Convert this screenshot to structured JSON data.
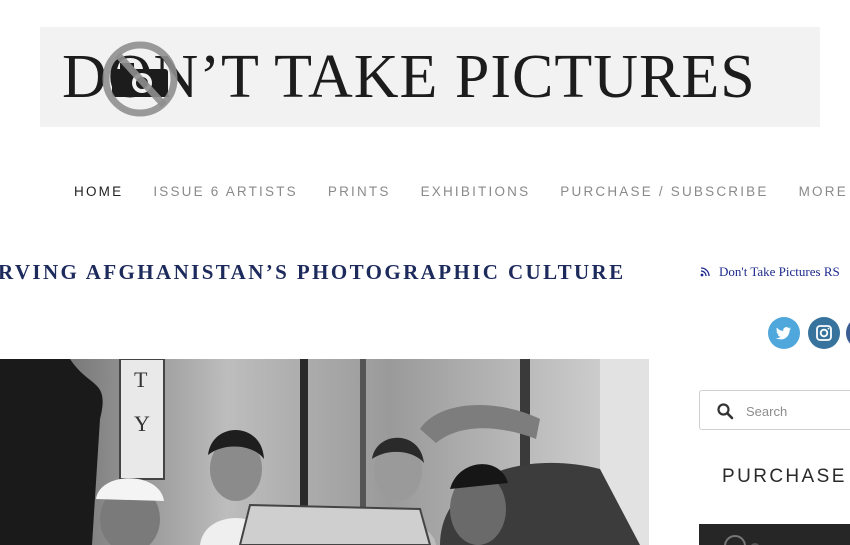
{
  "header": {
    "logo_text": "DON’T TAKE PICTURES"
  },
  "nav": {
    "items": [
      {
        "label": "HOME",
        "active": true
      },
      {
        "label": "ISSUE 6 ARTISTS",
        "active": false
      },
      {
        "label": "PRINTS",
        "active": false
      },
      {
        "label": "EXHIBITIONS",
        "active": false
      },
      {
        "label": "PURCHASE / SUBSCRIBE",
        "active": false
      },
      {
        "label": "MORE",
        "active": false
      }
    ]
  },
  "post": {
    "title": "RVING AFGHANISTAN’S PHOTOGRAPHIC CULTURE"
  },
  "sidebar": {
    "rss_label": "Don't Take Pictures RS",
    "social": [
      "twitter-icon",
      "instagram-icon",
      "facebook-icon"
    ],
    "search_placeholder": "Search",
    "widget_title": "PURCHASE I"
  },
  "colors": {
    "title": "#1d2a5c",
    "nav_active": "#222222",
    "nav_inactive": "#8a8a8a",
    "rss_link": "#1d2a8c",
    "twitter": "#4fa7dc",
    "instagram": "#37739c"
  }
}
